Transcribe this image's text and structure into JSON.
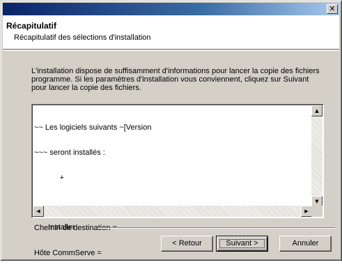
{
  "window": {
    "close_glyph": "✕"
  },
  "header": {
    "title": "Récapitulatif",
    "subtitle": "Récapitulatif des sélections d'installation"
  },
  "intro": {
    "text": "L'installation dispose de suffisamment d'informations pour lancer la copie des fichiers programme. Si les paramètres d'installation vous conviennent, cliquez sur Suivant pour lancer la copie des fichiers."
  },
  "summary": {
    "lines": [
      "~~ Les logiciels suivants ~[Version",
      "~~~ seront installés :",
      "            +",
      "",
      "Chemin de destination =",
      "Hôte CommServe ="
    ]
  },
  "scrollbars": {
    "up_glyph": "▲",
    "down_glyph": "▼",
    "left_glyph": "◀",
    "right_glyph": "▶"
  },
  "footer": {
    "group_label": "Installer",
    "back_label": "< Retour",
    "next_label": "Suivant >",
    "cancel_label": "Annuler"
  }
}
